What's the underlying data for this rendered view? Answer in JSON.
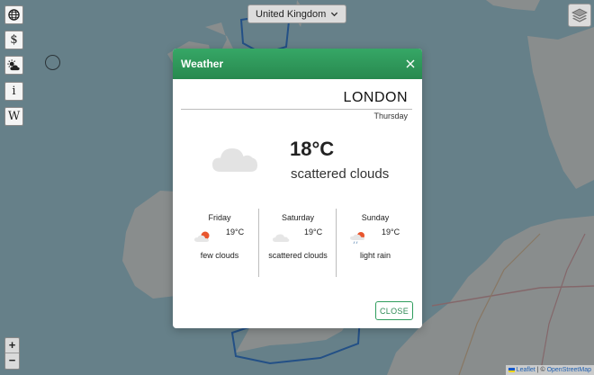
{
  "app": {
    "country_selector": {
      "selected": "United Kingdom"
    },
    "toolbar": [
      {
        "name": "globe-icon"
      },
      {
        "name": "dollar-icon",
        "glyph": "$"
      },
      {
        "name": "weather-icon"
      },
      {
        "name": "info-icon",
        "glyph": "i"
      },
      {
        "name": "wikipedia-icon",
        "glyph": "W"
      }
    ],
    "zoom": {
      "in_label": "+",
      "out_label": "−"
    },
    "attribution": {
      "leaflet": "Leaflet",
      "separator": " | © ",
      "osm": "OpenStreetMap"
    }
  },
  "modal": {
    "title": "Weather",
    "city": "LONDON",
    "today": {
      "day": "Thursday",
      "temperature": "18°C",
      "description": "scattered clouds",
      "icon": "cloud-icon"
    },
    "forecast": [
      {
        "day": "Friday",
        "temperature": "19°C",
        "description": "few clouds",
        "icon": "sun-cloud-icon"
      },
      {
        "day": "Saturday",
        "temperature": "19°C",
        "description": "scattered clouds",
        "icon": "cloud-icon"
      },
      {
        "day": "Sunday",
        "temperature": "19°C",
        "description": "light rain",
        "icon": "rain-icon"
      }
    ],
    "close_button": "CLOSE"
  },
  "colors": {
    "header_green": "#2f9d5d",
    "sea": "#aad3df",
    "land": "#f2efe9",
    "highlight_border": "#1e6fd9"
  }
}
